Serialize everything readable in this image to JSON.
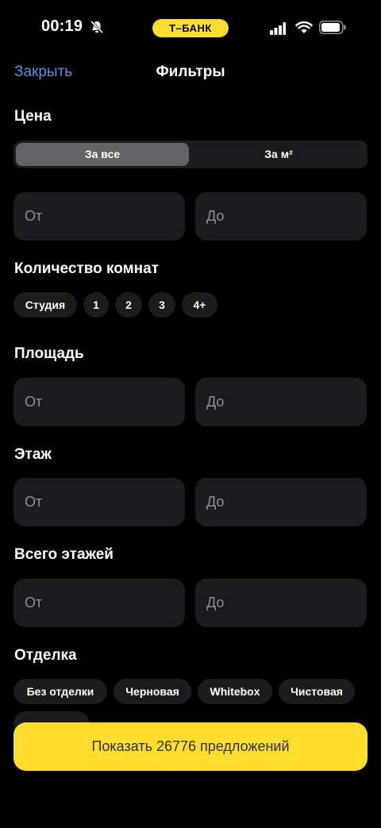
{
  "status_bar": {
    "time": "00:19",
    "carrier_pill": "Т–БАНК"
  },
  "nav": {
    "close": "Закрыть",
    "title": "Фильтры"
  },
  "price": {
    "title": "Цена",
    "segments": [
      "За все",
      "За м²"
    ],
    "selected_segment": "За все",
    "from_placeholder": "От",
    "to_placeholder": "До"
  },
  "rooms": {
    "title": "Количество комнат",
    "options": [
      "Студия",
      "1",
      "2",
      "3",
      "4+"
    ]
  },
  "area": {
    "title": "Площадь",
    "from_placeholder": "От",
    "to_placeholder": "До"
  },
  "floor": {
    "title": "Этаж",
    "from_placeholder": "От",
    "to_placeholder": "До"
  },
  "total_floors": {
    "title": "Всего этажей",
    "from_placeholder": "От",
    "to_placeholder": "До"
  },
  "finish": {
    "title": "Отделка",
    "options": [
      "Без отделки",
      "Черновая",
      "Whitebox",
      "Чистовая"
    ]
  },
  "cta": {
    "label": "Показать 26776 предложений"
  },
  "colors": {
    "accent": "#ffdd2d",
    "link": "#5b8fdb",
    "field_bg": "#1c1c1e"
  },
  "icons": [
    "bell-muted-icon",
    "cellular-signal-icon",
    "wifi-icon",
    "battery-icon"
  ]
}
